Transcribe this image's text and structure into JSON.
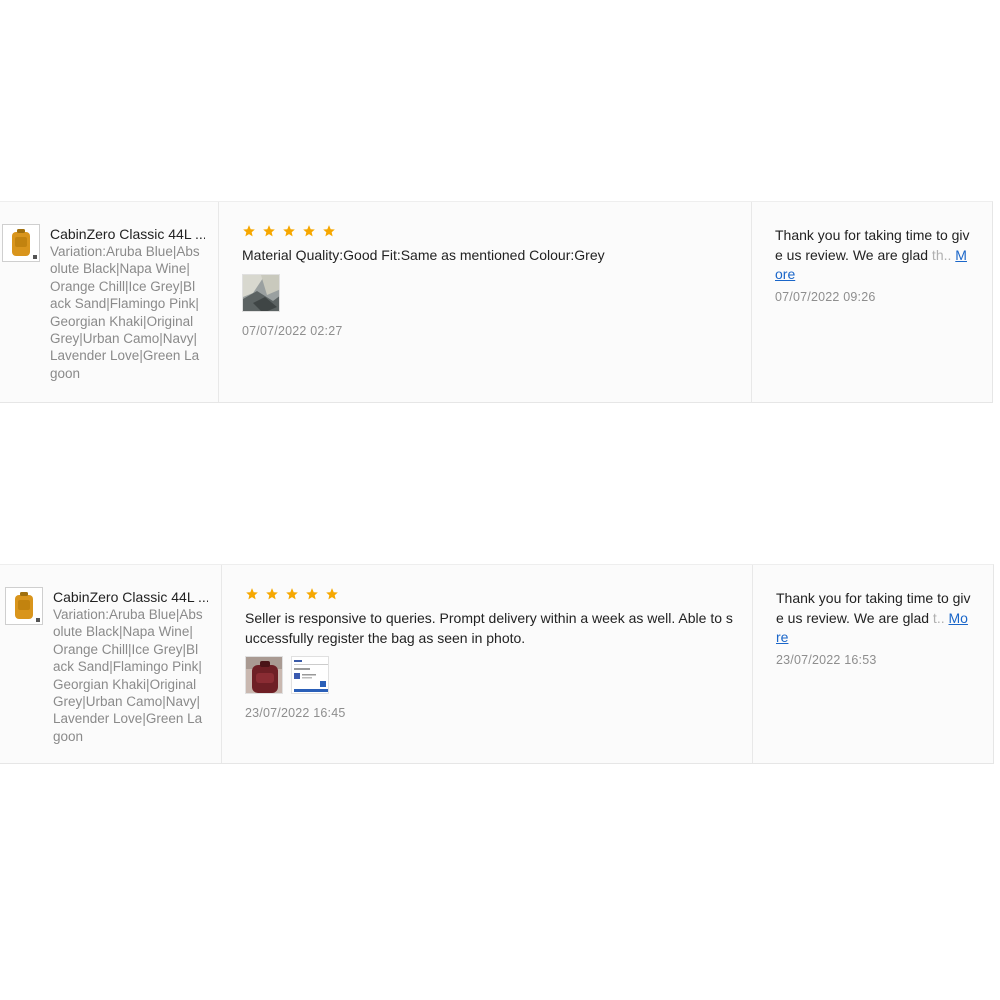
{
  "reviews": [
    {
      "product_name": "CabinZero Classic 44L ...",
      "variation": "Variation:Aruba Blue|Absolute Black|Napa Wine|Orange Chill|Ice Grey|Black Sand|Flamingo Pink|Georgian Khaki|Original Grey|Urban Camo|Navy|Lavender Love|Green Lagoon",
      "rating": 5,
      "text": "Material Quality:Good Fit:Same as mentioned Colour:Grey",
      "date": "07/07/2022 02:27",
      "reply_text": "Thank you for taking time to give us review. We are glad",
      "reply_fade": " th..",
      "reply_more": "More",
      "reply_date": "07/07/2022 09:26"
    },
    {
      "product_name": "CabinZero Classic 44L ...",
      "variation": "Variation:Aruba Blue|Absolute Black|Napa Wine|Orange Chill|Ice Grey|Black Sand|Flamingo Pink|Georgian Khaki|Original Grey|Urban Camo|Navy|Lavender Love|Green Lagoon",
      "rating": 5,
      "text": "Seller is responsive to queries. Prompt delivery within a week as well. Able to successfully register the bag as seen in photo.",
      "date": "23/07/2022 16:45",
      "reply_text": "Thank you for taking time to give us review. We are glad",
      "reply_fade": " t..",
      "reply_more": "More",
      "reply_date": "23/07/2022 16:53"
    }
  ],
  "colors": {
    "star": "#f6a700",
    "link": "#1a66c9",
    "muted": "#8e8e8e"
  },
  "icons": {
    "star": "star-icon",
    "product": "backpack-thumbnail"
  }
}
